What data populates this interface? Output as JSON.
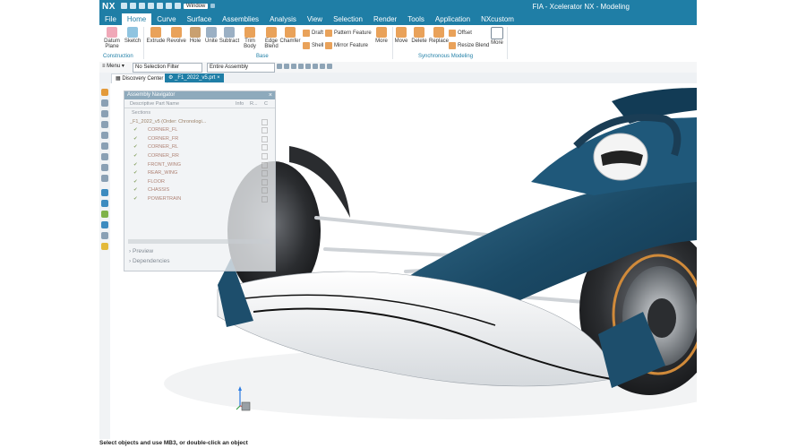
{
  "app": {
    "logo": "NX",
    "window_menu": "Window",
    "title": "FIA  -  Xcelerator NX - Modeling"
  },
  "menubar": [
    "File",
    "Home",
    "Curve",
    "Surface",
    "Assemblies",
    "Analysis",
    "View",
    "Selection",
    "Render",
    "Tools",
    "Application",
    "NXcustom"
  ],
  "ribbon": {
    "construction": {
      "datum_plane": "Datum Plane",
      "sketch": "Sketch",
      "label": "Construction"
    },
    "base": {
      "extrude": "Extrude",
      "revolve": "Revolve",
      "hole": "Hole",
      "unite": "Unite",
      "subtract": "Subtract",
      "trim_body": "Trim Body",
      "edge_blend": "Edge Blend",
      "chamfer": "Chamfer",
      "draft": "Draft",
      "pattern_feature": "Pattern Feature",
      "shell": "Shell",
      "mirror_feature": "Mirror Feature",
      "more": "More",
      "label": "Base"
    },
    "sync": {
      "move": "Move",
      "delete": "Delete",
      "replace": "Replace",
      "offset": "Offset",
      "resize_blend": "Resize Blend",
      "more": "More",
      "label": "Synchronous Modeling"
    }
  },
  "selection_bar": {
    "menu": "Menu",
    "filter": "No Selection Filter",
    "scope": "Entire Assembly"
  },
  "tabs": {
    "discovery": "Discovery Center",
    "part": "_F1_2022_v5.prt"
  },
  "navigator": {
    "title": "Assembly Navigator",
    "col_name": "Descriptive Part Name",
    "col_info": "Info",
    "col_r": "R...",
    "col_c": "C",
    "sections": "Sections",
    "root": "_F1_2022_v5 (Order: Chronologi...",
    "components": [
      "CORNER_FL",
      "CORNER_FR",
      "CORNER_RL",
      "CORNER_RR",
      "FRONT_WING",
      "REAR_WING",
      "FLOOR",
      "CHASSIS",
      "POWERTRAIN"
    ],
    "preview": "Preview",
    "dependencies": "Dependencies"
  },
  "status": "Select objects and use MB3, or double-click an object",
  "colors": {
    "accent": "#1f7ea6",
    "car_body": "#1b4a66",
    "tire": "#2b2d30",
    "tire_stripe": "#d08a3a"
  }
}
